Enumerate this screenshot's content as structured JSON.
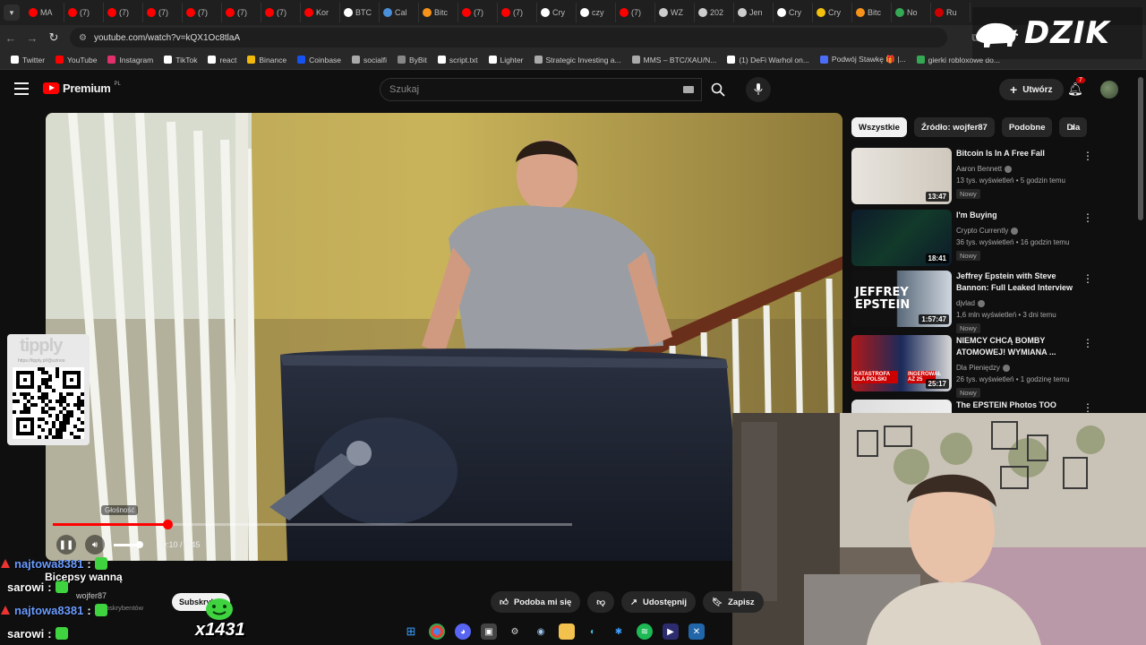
{
  "tabs": [
    {
      "label": "MA",
      "color": "#ff0000"
    },
    {
      "label": "(7)",
      "color": "#ff0000"
    },
    {
      "label": "(7)",
      "color": "#ff0000"
    },
    {
      "label": "(7)",
      "color": "#ff0000"
    },
    {
      "label": "(7)",
      "color": "#ff0000"
    },
    {
      "label": "(7)",
      "color": "#ff0000"
    },
    {
      "label": "(7)",
      "color": "#ff0000"
    },
    {
      "label": "Kor",
      "color": "#ff0000"
    },
    {
      "label": "BTC",
      "color": "#ffffff"
    },
    {
      "label": "Cal",
      "color": "#4a90d9"
    },
    {
      "label": "Bitc",
      "color": "#f7931a"
    },
    {
      "label": "(7)",
      "color": "#ff0000"
    },
    {
      "label": "(7)",
      "color": "#ff0000"
    },
    {
      "label": "Cry",
      "color": "#ffffff"
    },
    {
      "label": "czy",
      "color": "#ffffff"
    },
    {
      "label": "(7)",
      "color": "#ff0000"
    },
    {
      "label": "WZ",
      "color": "#cccccc"
    },
    {
      "label": "202",
      "color": "#cccccc"
    },
    {
      "label": "Jen",
      "color": "#cccccc"
    },
    {
      "label": "Cry",
      "color": "#ffffff"
    },
    {
      "label": "Cry",
      "color": "#f4c20d"
    },
    {
      "label": "Bitc",
      "color": "#f7931a"
    },
    {
      "label": "No",
      "color": "#34a853"
    },
    {
      "label": "Ru",
      "color": "#cc0000"
    }
  ],
  "address": {
    "url": "youtube.com/watch?v=kQX1Oc8tlaA"
  },
  "bookmarks": [
    {
      "label": "Twitter",
      "color": "#ffffff"
    },
    {
      "label": "YouTube",
      "color": "#ff0000"
    },
    {
      "label": "Instagram",
      "color": "#e1306c"
    },
    {
      "label": "TikTok",
      "color": "#ffffff"
    },
    {
      "label": "react",
      "color": "#ffffff"
    },
    {
      "label": "Binance",
      "color": "#f0b90b"
    },
    {
      "label": "Coinbase",
      "color": "#1652f0"
    },
    {
      "label": "socialfi",
      "color": "#aaaaaa"
    },
    {
      "label": "ByBit",
      "color": "#888888"
    },
    {
      "label": "script.txt",
      "color": "#ffffff"
    },
    {
      "label": "Lighter",
      "color": "#ffffff"
    },
    {
      "label": "Strategic Investing a...",
      "color": "#aaaaaa"
    },
    {
      "label": "MMS – BTC/XAU/N...",
      "color": "#aaaaaa"
    },
    {
      "label": "(1) DeFi Warhol on...",
      "color": "#ffffff"
    },
    {
      "label": "Podwój Stawkę 🎁 |...",
      "color": "#4a6cf7"
    },
    {
      "label": "gierki robloxowe do...",
      "color": "#34a853"
    }
  ],
  "overlay_logo": "DZIK",
  "header": {
    "brand": "Premium",
    "region": "PL",
    "search_placeholder": "Szukaj",
    "create_label": "Utwórz",
    "notification_count": "7"
  },
  "player": {
    "current_time": "0:10",
    "duration": "0:45",
    "time_display": "0:10 / 0:45",
    "progress": 0.22,
    "volume_tooltip": "Głośność"
  },
  "tippy": {
    "brand": "tipply",
    "url": "https://tipply.pl/@szinoo"
  },
  "chips": [
    {
      "label": "Wszystkie",
      "active": true
    },
    {
      "label": "Źródło: wojfer87",
      "active": false
    },
    {
      "label": "Podobne",
      "active": false
    },
    {
      "label": "Dla",
      "active": false
    }
  ],
  "recommendations": [
    {
      "title": "Bitcoin Is In A Free Fall",
      "channel": "Aaron Bennett",
      "meta": "13 tys. wyświetleń • 5 godzin temu",
      "badge": "Nowy",
      "duration": "13:47"
    },
    {
      "title": "I'm Buying",
      "channel": "Crypto Currently",
      "meta": "36 tys. wyświetleń • 16 godzin temu",
      "badge": "Nowy",
      "duration": "18:41"
    },
    {
      "title": "Jeffrey Epstein with Steve Bannon: Full Leaked Interview",
      "channel": "djvlad",
      "meta": "1,6 mln wyświetleń • 3 dni temu",
      "badge": "Nowy",
      "duration": "1:57:47",
      "thumb_text": "JEFFREY EPSTEIN"
    },
    {
      "title": "NIEMCY CHCĄ BOMBY ATOMOWEJ! WYMIANA ...",
      "channel": "Dla Pieniędzy",
      "meta": "26 tys. wyświetleń • 1 godzinę temu",
      "badge": "Nowy",
      "duration": "25:17",
      "thumb_text_1": "KATASTROFA DLA POLSKI",
      "thumb_text_2": "INGEROWAŁ AŻ 25"
    },
    {
      "title": "The EPSTEIN Photos TOO",
      "channel": "",
      "meta": "",
      "badge": "",
      "duration": ""
    }
  ],
  "below_video": {
    "channel": "wojfer87",
    "subscribers": "subskrybentów",
    "subscribe_label": "Subskrybuj",
    "like_label": "Podoba mi się",
    "share_label": "Udostępnij",
    "save_label": "Zapisz"
  },
  "combo": "x1431",
  "chat": [
    {
      "user": "najtowa8381",
      "color": "#6c9cff",
      "text": "Bicepsy wanną"
    },
    {
      "user": "sarowi",
      "color": "#ffffff",
      "text": ""
    },
    {
      "user": "najtowa8381",
      "color": "#6c9cff",
      "text": ""
    },
    {
      "user": "sarowi",
      "color": "#ffffff",
      "text": ""
    }
  ]
}
